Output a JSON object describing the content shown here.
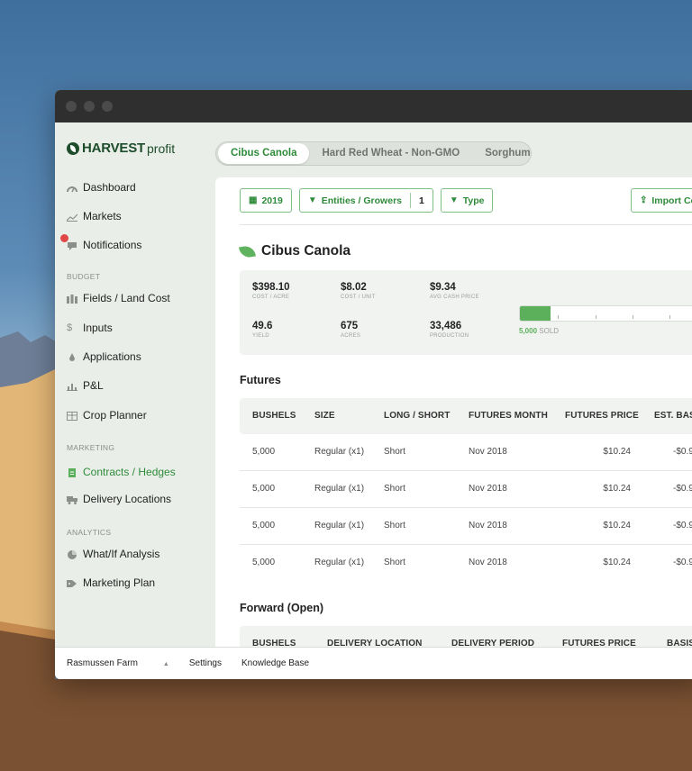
{
  "window": {
    "title": ""
  },
  "sidebar": {
    "logo_bold": "HARVEST",
    "logo_light": "profit",
    "items": [
      {
        "label": "Dashboard",
        "icon": "dashboard-icon"
      },
      {
        "label": "Markets",
        "icon": "markets-icon"
      },
      {
        "label": "Notifications",
        "icon": "notifications-icon"
      },
      {
        "label": "Fields / Land Cost",
        "icon": "fields-icon"
      },
      {
        "label": "Inputs",
        "icon": "inputs-icon"
      },
      {
        "label": "Applications",
        "icon": "applications-icon"
      },
      {
        "label": "P&L",
        "icon": "pl-icon"
      },
      {
        "label": "Crop Planner",
        "icon": "crop-planner-icon"
      },
      {
        "label": "Contracts / Hedges",
        "icon": "contracts-icon"
      },
      {
        "label": "Delivery Locations",
        "icon": "delivery-icon"
      },
      {
        "label": "What/If Analysis",
        "icon": "whatif-icon"
      },
      {
        "label": "Marketing Plan",
        "icon": "marketing-plan-icon"
      }
    ],
    "sections": {
      "budget": "BUDGET",
      "marketing": "MARKETING",
      "analytics": "ANALYTICS"
    }
  },
  "crop_tabs": [
    "Cibus Canola",
    "Hard Red Wheat - Non-GMO",
    "Sorghum"
  ],
  "filters": {
    "year": "2019",
    "entities": "Entities / Growers",
    "entities_count": "1",
    "type": "Type",
    "import": "Import Co"
  },
  "crop": {
    "title": "Cibus Canola",
    "stats": {
      "cost_acre": {
        "value": "$398.10",
        "label": "COST / ACRE"
      },
      "cost_unit": {
        "value": "$8.02",
        "label": "COST / UNIT"
      },
      "avg_cash": {
        "value": "$9.34",
        "label": "AVG CASH PRICE"
      },
      "yield": {
        "value": "49.6",
        "label": "YIELD"
      },
      "acres": {
        "value": "675",
        "label": "ACRES"
      },
      "production": {
        "value": "33,486",
        "label": "PRODUCTION"
      }
    },
    "sold": {
      "amount": "5,000",
      "label": "SOLD",
      "fraction": 0.149
    }
  },
  "futures": {
    "title": "Futures",
    "headers": [
      "BUSHELS",
      "SIZE",
      "LONG / SHORT",
      "FUTURES MONTH",
      "FUTURES PRICE",
      "EST. BAS"
    ],
    "rows": [
      [
        "5,000",
        "Regular (x1)",
        "Short",
        "Nov 2018",
        "$10.24",
        "-$0.9"
      ],
      [
        "5,000",
        "Regular (x1)",
        "Short",
        "Nov 2018",
        "$10.24",
        "-$0.9"
      ],
      [
        "5,000",
        "Regular (x1)",
        "Short",
        "Nov 2018",
        "$10.24",
        "-$0.9"
      ],
      [
        "5,000",
        "Regular (x1)",
        "Short",
        "Nov 2018",
        "$10.24",
        "-$0.9"
      ]
    ]
  },
  "forward": {
    "title": "Forward (Open)",
    "headers": [
      "BUSHELS",
      "DELIVERY LOCATION",
      "DELIVERY PERIOD",
      "FUTURES PRICE",
      "BASIS"
    ]
  },
  "footer": {
    "farm": "Rasmussen Farm",
    "settings": "Settings",
    "kb": "Knowledge Base"
  }
}
